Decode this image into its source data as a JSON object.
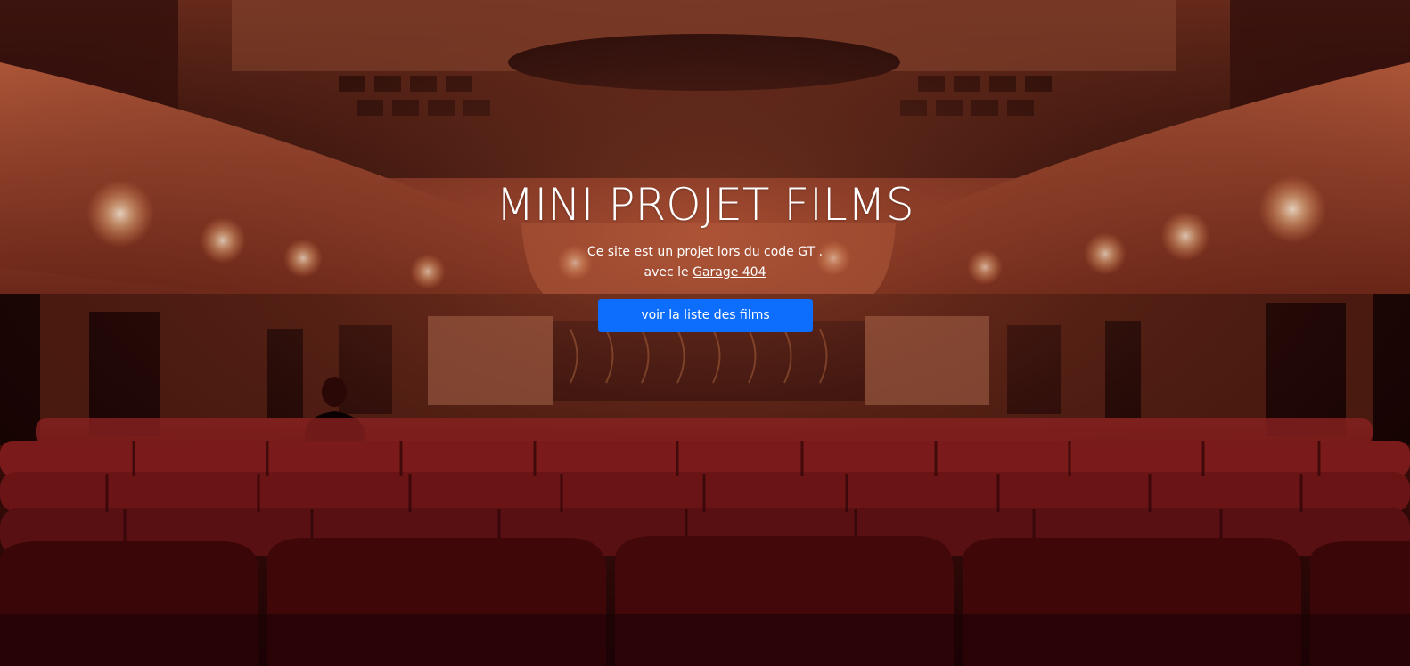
{
  "hero": {
    "title": "MINI PROJET FILMS",
    "lead_line1": "Ce site est un projet lors du code GT .",
    "lead_line2_prefix": "avec le ",
    "lead_link": "Garage 404",
    "button_label": "voir la liste des films"
  },
  "colors": {
    "button": "#0d6efd",
    "text": "#ffffff",
    "seats": "#7a1418",
    "walls": "#8a3a26"
  },
  "background_image": "cinema-theater-photo"
}
